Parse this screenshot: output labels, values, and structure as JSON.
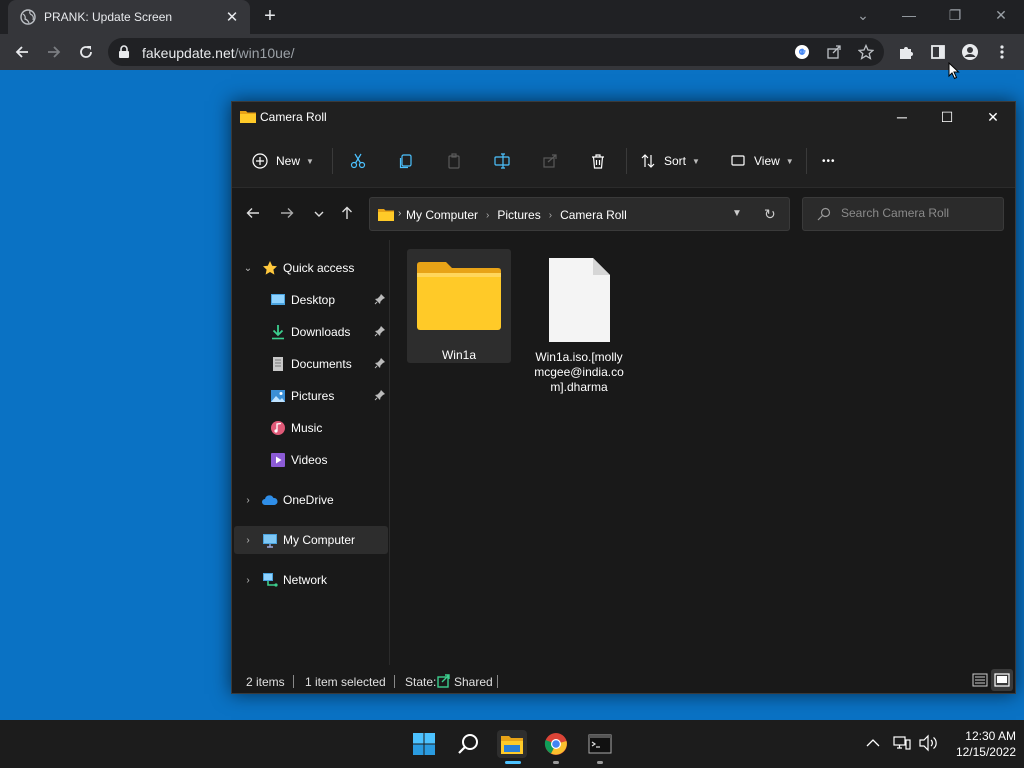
{
  "browser": {
    "tab_title": "PRANK: Update Screen",
    "tab_close": "✕",
    "new_tab": "+",
    "url_host": "fakeupdate.net",
    "url_path": "/win10ue/"
  },
  "explorer": {
    "title": "Camera Roll",
    "commands": {
      "new_label": "New",
      "sort_label": "Sort",
      "view_label": "View",
      "more_label": "•••"
    },
    "breadcrumbs": [
      "My Computer",
      "Pictures",
      "Camera Roll"
    ],
    "search_placeholder": "Search Camera Roll",
    "nav": {
      "quick_access": "Quick access",
      "items": [
        {
          "label": "Desktop",
          "pinned": true
        },
        {
          "label": "Downloads",
          "pinned": true
        },
        {
          "label": "Documents",
          "pinned": true
        },
        {
          "label": "Pictures",
          "pinned": true
        },
        {
          "label": "Music",
          "pinned": false
        },
        {
          "label": "Videos",
          "pinned": false
        }
      ],
      "onedrive": "OneDrive",
      "my_computer": "My Computer",
      "network": "Network"
    },
    "files": [
      {
        "name": "Win1a",
        "type": "folder",
        "selected": true
      },
      {
        "name": "Win1a.iso.[mollymcgee@india.com].dharma",
        "type": "file",
        "selected": false
      }
    ],
    "status": {
      "items": "2 items",
      "selected": "1 item selected",
      "state_label": "State:",
      "state_value": "Shared"
    }
  },
  "taskbar": {
    "time": "12:30 AM",
    "date": "12/15/2022"
  },
  "colors": {
    "desktop": "#0a72c4",
    "folder": "#ffca28",
    "accent": "#4cc2ff"
  }
}
